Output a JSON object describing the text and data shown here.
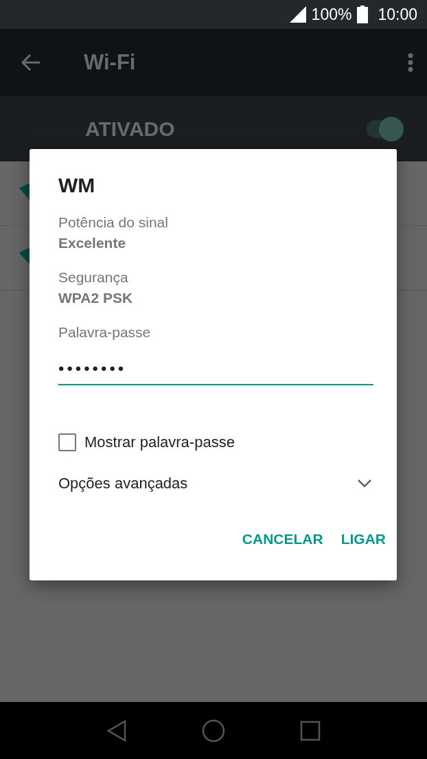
{
  "status_bar": {
    "battery": "100%",
    "time": "10:00"
  },
  "toolbar": {
    "title": "Wi-Fi"
  },
  "wifi_switch": {
    "label": "ATIVADO",
    "on": true
  },
  "dialog": {
    "title": "WM",
    "details": [
      {
        "label": "Potência do sinal",
        "value": "Excelente"
      },
      {
        "label": "Segurança",
        "value": "WPA2 PSK"
      }
    ],
    "password": {
      "label": "Palavra-passe",
      "value": "••••••••"
    },
    "show_password": {
      "label": "Mostrar palavra-passe",
      "checked": false
    },
    "advanced": {
      "label": "Opções avançadas",
      "expanded": false
    },
    "buttons": [
      "CANCELAR",
      "LIGAR"
    ]
  }
}
